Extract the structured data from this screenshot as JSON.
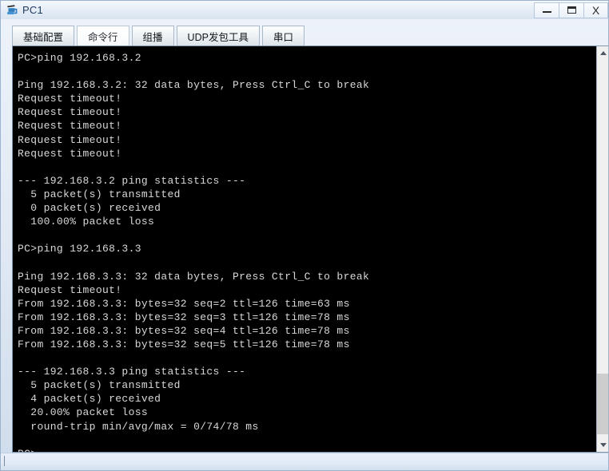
{
  "window": {
    "title": "PC1",
    "icon": "pc-network-icon",
    "controls": [
      {
        "name": "minimize-button",
        "label": "–"
      },
      {
        "name": "maximize-button",
        "label": "❐"
      },
      {
        "name": "close-button",
        "label": "X"
      }
    ]
  },
  "tabs": [
    {
      "label": "基础配置",
      "selected": false
    },
    {
      "label": "命令行",
      "selected": true
    },
    {
      "label": "组播",
      "selected": false
    },
    {
      "label": "UDP发包工具",
      "selected": false
    },
    {
      "label": "串口",
      "selected": false
    }
  ],
  "terminal": {
    "background": "#000000",
    "foreground": "#d8d8d8",
    "lines": [
      "PC>ping 192.168.3.2",
      "",
      "Ping 192.168.3.2: 32 data bytes, Press Ctrl_C to break",
      "Request timeout!",
      "Request timeout!",
      "Request timeout!",
      "Request timeout!",
      "Request timeout!",
      "",
      "--- 192.168.3.2 ping statistics ---",
      "  5 packet(s) transmitted",
      "  0 packet(s) received",
      "  100.00% packet loss",
      "",
      "PC>ping 192.168.3.3",
      "",
      "Ping 192.168.3.3: 32 data bytes, Press Ctrl_C to break",
      "Request timeout!",
      "From 192.168.3.3: bytes=32 seq=2 ttl=126 time=63 ms",
      "From 192.168.3.3: bytes=32 seq=3 ttl=126 time=78 ms",
      "From 192.168.3.3: bytes=32 seq=4 ttl=126 time=78 ms",
      "From 192.168.3.3: bytes=32 seq=5 ttl=126 time=78 ms",
      "",
      "--- 192.168.3.3 ping statistics ---",
      "  5 packet(s) transmitted",
      "  4 packet(s) received",
      "  20.00% packet loss",
      "  round-trip min/avg/max = 0/74/78 ms",
      "",
      "PC>"
    ]
  },
  "scrollbar": {
    "up_arrow": "chevron-up-icon",
    "down_arrow": "chevron-down-icon",
    "thumb_top_pct": 83,
    "thumb_height_pct": 16
  }
}
